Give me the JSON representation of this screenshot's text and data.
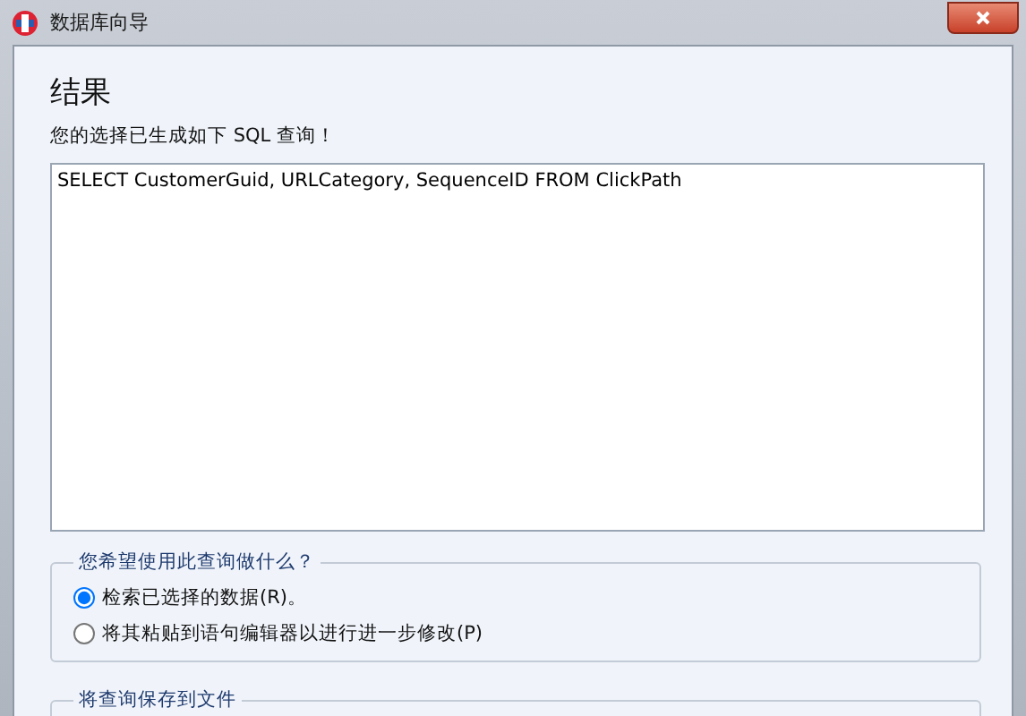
{
  "window": {
    "title": "数据库向导"
  },
  "heading": "结果",
  "subtitle": "您的选择已生成如下 SQL 查询！",
  "query": {
    "value": "SELECT CustomerGuid, URLCategory, SequenceID FROM ClickPath"
  },
  "usage_group": {
    "title": "您希望使用此查询做什么？",
    "options": [
      {
        "label": "检索已选择的数据(R)。",
        "selected": true
      },
      {
        "label": "将其粘贴到语句编辑器以进行进一步修改(P)",
        "selected": false
      }
    ]
  },
  "save_group": {
    "title": "将查询保存到文件"
  }
}
